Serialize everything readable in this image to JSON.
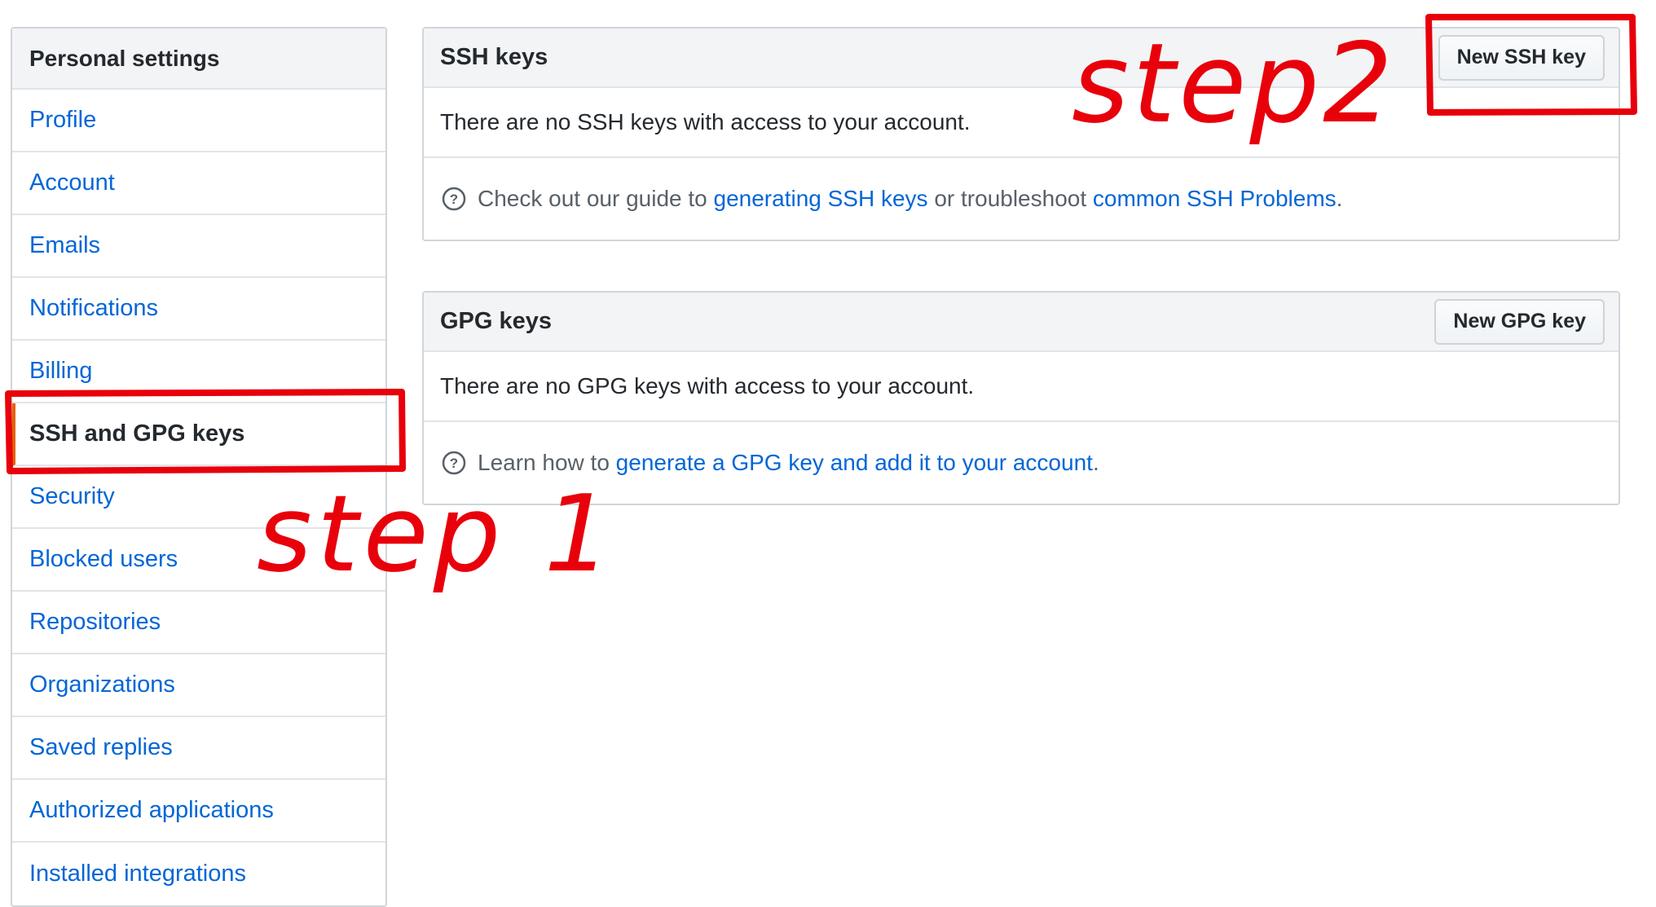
{
  "sidebar": {
    "header": "Personal settings",
    "items": [
      {
        "label": "Profile"
      },
      {
        "label": "Account"
      },
      {
        "label": "Emails"
      },
      {
        "label": "Notifications"
      },
      {
        "label": "Billing"
      },
      {
        "label": "SSH and GPG keys",
        "selected": true
      },
      {
        "label": "Security"
      },
      {
        "label": "Blocked users"
      },
      {
        "label": "Repositories"
      },
      {
        "label": "Organizations"
      },
      {
        "label": "Saved replies"
      },
      {
        "label": "Authorized applications"
      },
      {
        "label": "Installed integrations"
      }
    ]
  },
  "ssh": {
    "title": "SSH keys",
    "button": "New SSH key",
    "empty": "There are no SSH keys with access to your account.",
    "help_prefix": "Check out our guide to ",
    "help_link1": "generating SSH keys",
    "help_middle": " or troubleshoot ",
    "help_link2": "common SSH Problems",
    "help_suffix": "."
  },
  "gpg": {
    "title": "GPG keys",
    "button": "New GPG key",
    "empty": "There are no GPG keys with access to your account.",
    "help_prefix": "Learn how to ",
    "help_link": "generate a GPG key and add it to your account",
    "help_suffix": "."
  },
  "annotations": {
    "step1": "step 1",
    "step2": "step2",
    "color": "#e8000b"
  },
  "colors": {
    "link": "#0366d6",
    "selected_accent": "#e36209",
    "header_bg": "#f3f4f6"
  }
}
